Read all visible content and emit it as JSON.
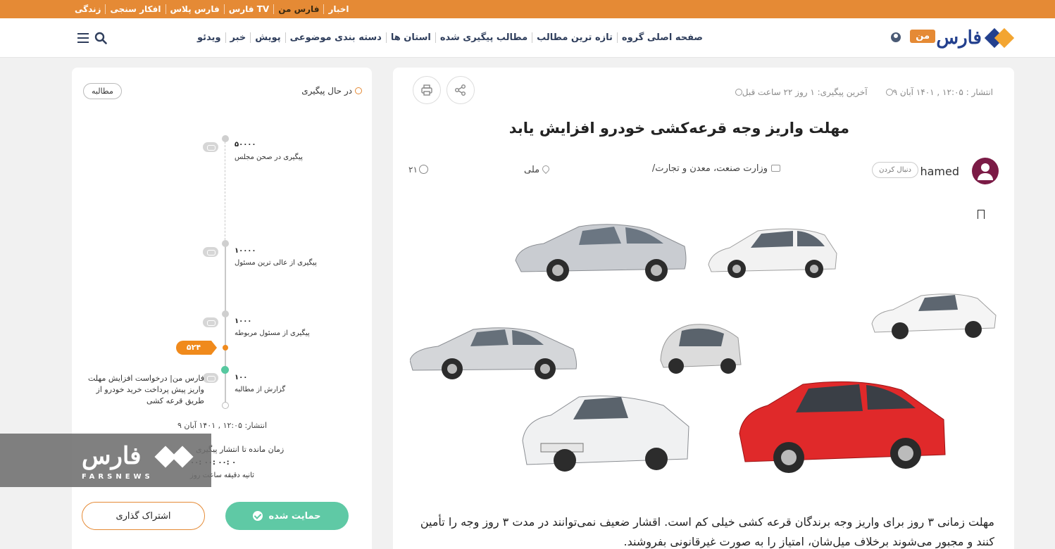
{
  "topbar": {
    "links": [
      "اخبار",
      "فارس من",
      "فارس TV",
      "فارس پلاس",
      "افکار سنجی",
      "زندگی"
    ],
    "active_index": 1
  },
  "header": {
    "logo_text": "فارس",
    "man_badge": "من",
    "nav": [
      "صفحه اصلی گروه",
      "تازه ترین مطالب",
      "مطالب پیگیری شده",
      "استان ها",
      "دسته بندی موضوعی",
      "پویش",
      "خبر",
      "ویدئو"
    ]
  },
  "article": {
    "publish": "انتشار : ۱۲:۰۵ , ۱۴۰۱ آبان ۹",
    "last_followup": "آخرین پیگیری: ۱ روز ۲۲ ساعت قبل",
    "title": "مهلت واریز وجه قرعه‌کشی خودرو افزایش یابد",
    "author": "hamed",
    "follow_label": "دنبال کردن",
    "category": "وزارت صنعت، معدن و تجارت/",
    "location": "ملی",
    "comments": "۲۱",
    "body": "مهلت زمانی ۳ روز برای واریز وجه برندگان قرعه کشی خیلی کم است. اقشار ضعیف نمی‌توانند در مدت ۳ روز وجه را تأمین کنند و مجبور می‌شوند برخلاف میل‌شان، امتیاز را به صورت غیرقانونی بفروشند."
  },
  "sidebar": {
    "status": "در حال پیگیری",
    "tag": "مطالبه",
    "timeline": [
      {
        "num": "۵۰۰۰۰",
        "label": "پیگیری در صحن مجلس"
      },
      {
        "num": "۱۰۰۰۰",
        "label": "پیگیری از عالی ترین مسئول"
      },
      {
        "num": "۱۰۰۰",
        "label": "پیگیری از مسئول مربوطه"
      },
      {
        "num": "۱۰۰",
        "label": "گزارش از مطالبه"
      }
    ],
    "count": "۵۲۴",
    "request_text": "فارس من| درخواست افزایش مهلت واریز پیش پرداخت خرید خودرو از طریق قرعه کشی",
    "publish": "انتشار: ۱۲:۰۵ , ۱۴۰۱ آبان ۹",
    "remaining": "زمان مانده تا انتشار پیگیری",
    "timer": "۰۰: ۰۰: ۰۰: ۰",
    "timer_units": "ثانیه دقیقه ساعت روز",
    "watermark_logo": "فارس",
    "watermark_sub": "FARSNEWS",
    "support_label": "حمایت شده",
    "share_label": "اشتراک گذاری"
  },
  "colors": {
    "brand_orange": "#e58a35",
    "brand_blue": "#23408e",
    "support_green": "#5fc9a5"
  }
}
